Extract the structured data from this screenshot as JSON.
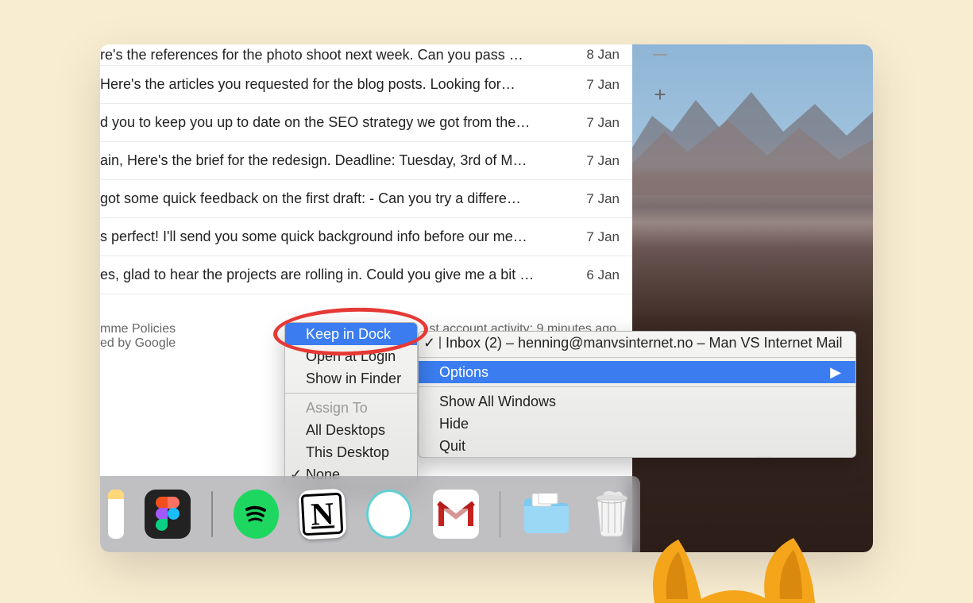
{
  "mail": {
    "rows": [
      {
        "subject": "re's the references for the photo shoot next week. Can you pass …",
        "date": "8 Jan"
      },
      {
        "subject": "Here's the articles you requested for the blog posts. Looking for…",
        "date": "7 Jan"
      },
      {
        "subject": "d you to keep you up to date on the SEO strategy we got from the…",
        "date": "7 Jan"
      },
      {
        "subject": "ain, Here's the brief for the redesign. Deadline: Tuesday, 3rd of M…",
        "date": "7 Jan"
      },
      {
        "subject": "got some quick feedback on the first draft: - Can you try a differe…",
        "date": "7 Jan"
      },
      {
        "subject": "s perfect! I'll send you some quick background info before our me…",
        "date": "7 Jan"
      },
      {
        "subject": "es, glad to hear the projects are rolling in. Could you give me a bit …",
        "date": "6 Jan"
      }
    ]
  },
  "footer": {
    "policies": "mme Policies",
    "powered": "ed by Google",
    "activity": "st account activity: 9 minutes ago"
  },
  "context_menu": {
    "window_title": "Inbox (2) – henning@manvsinternet.no – Man VS Internet Mail",
    "options": "Options",
    "show_all": "Show All Windows",
    "hide": "Hide",
    "quit": "Quit"
  },
  "options_submenu": {
    "keep_in_dock": "Keep in Dock",
    "open_at_login": "Open at Login",
    "show_in_finder": "Show in Finder",
    "assign_to": "Assign To",
    "all_desktops": "All Desktops",
    "this_desktop": "This Desktop",
    "none": "None"
  },
  "dock": {
    "items": [
      {
        "name": "textedit"
      },
      {
        "name": "figma"
      },
      {
        "name": "spotify"
      },
      {
        "name": "notion"
      },
      {
        "name": "circle-app"
      },
      {
        "name": "gmail",
        "running": true
      },
      {
        "name": "downloads-folder"
      },
      {
        "name": "trash"
      }
    ]
  },
  "zoom": {
    "plus": "+"
  }
}
